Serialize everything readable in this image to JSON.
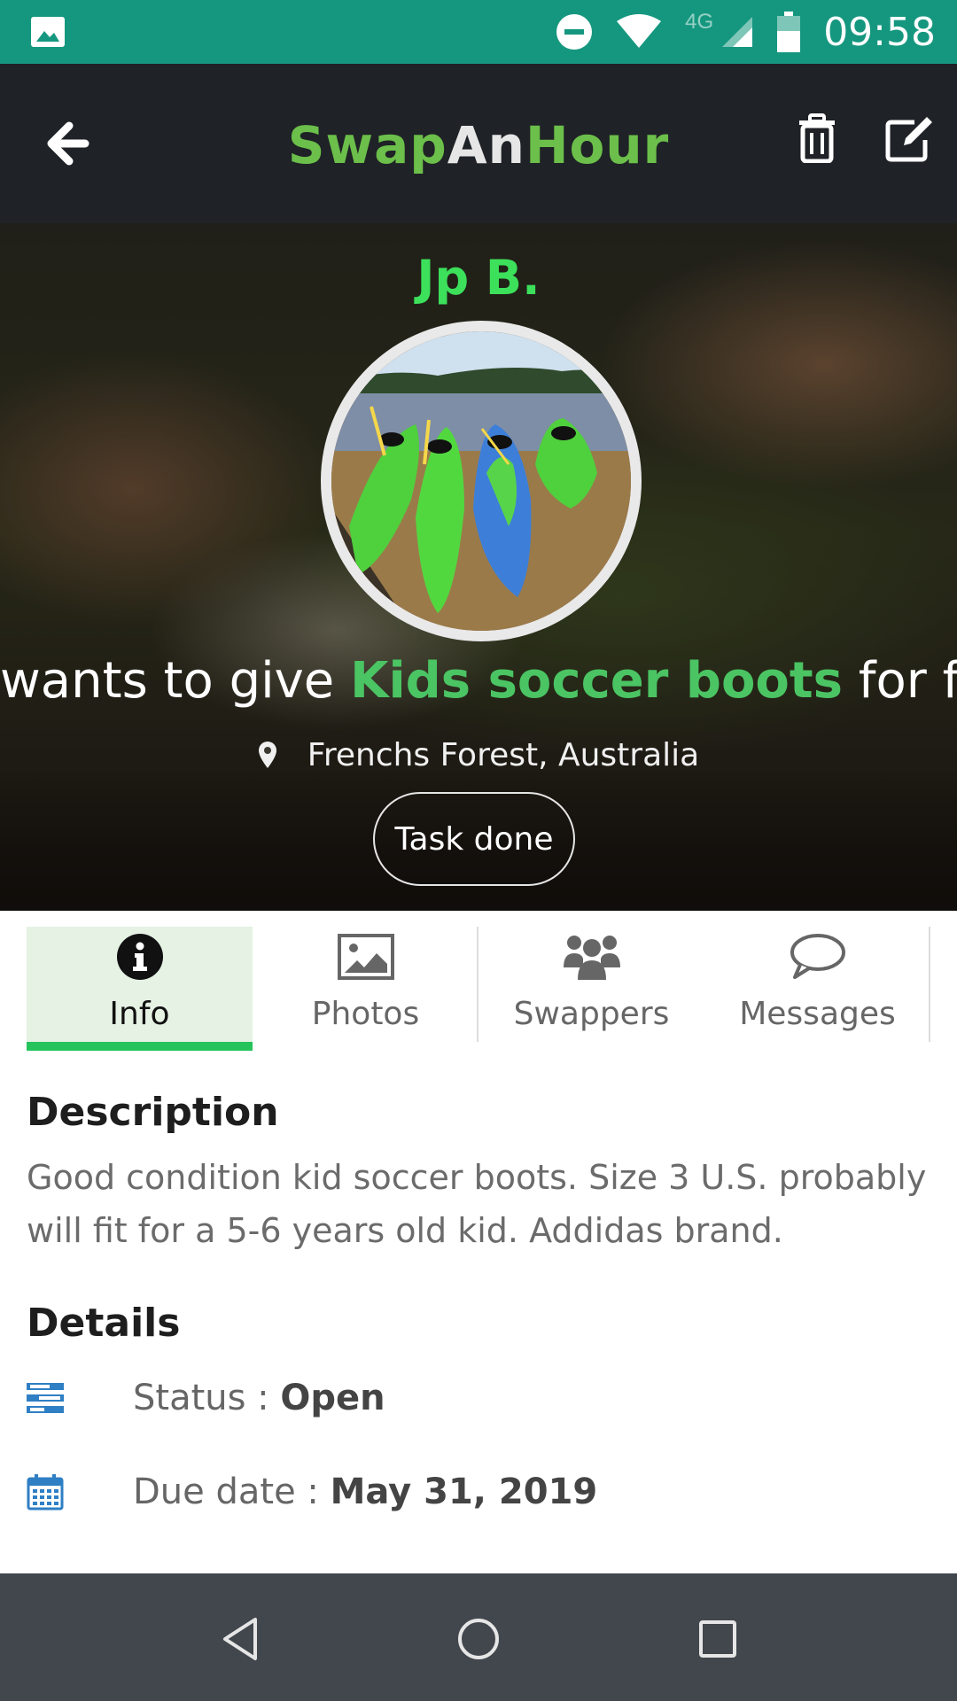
{
  "status_bar": {
    "time": "09:58",
    "network": "4G",
    "icons": [
      "image-icon",
      "do-not-disturb-icon",
      "wifi-icon",
      "signal-icon",
      "battery-icon"
    ]
  },
  "header": {
    "logo_parts": [
      "Swap",
      "An",
      "Hour"
    ],
    "back_icon": "back-arrow-icon",
    "delete_icon": "trash-icon",
    "edit_icon": "edit-icon"
  },
  "hero": {
    "user_name": "Jp B.",
    "headline_prefix": "wants to give ",
    "item_name": "Kids soccer boots",
    "headline_suffix": " for free",
    "location": "Frenchs Forest, Australia",
    "task_button": "Task done"
  },
  "tabs": [
    {
      "label": "Info",
      "icon": "info-icon",
      "active": true
    },
    {
      "label": "Photos",
      "icon": "photo-icon",
      "active": false
    },
    {
      "label": "Swappers",
      "icon": "users-icon",
      "active": false
    },
    {
      "label": "Messages",
      "icon": "chat-bubble-icon",
      "active": false
    }
  ],
  "description": {
    "title": "Description",
    "text": "Good condition kid soccer boots. Size 3 U.S. probably will fit for a 5-6 years old kid. Addidas brand."
  },
  "details": {
    "title": "Details",
    "status_label": "Status : ",
    "status_value": "Open",
    "due_label": "Due date : ",
    "due_value": "May 31, 2019"
  },
  "colors": {
    "status_bar": "#15977f",
    "app_bar": "#1f2226",
    "accent_green": "#24c35b",
    "user_name_green": "#3ce05a",
    "item_green": "#4bc463",
    "detail_icon_blue": "#2f7fc4",
    "nav_bar": "#42474d"
  }
}
